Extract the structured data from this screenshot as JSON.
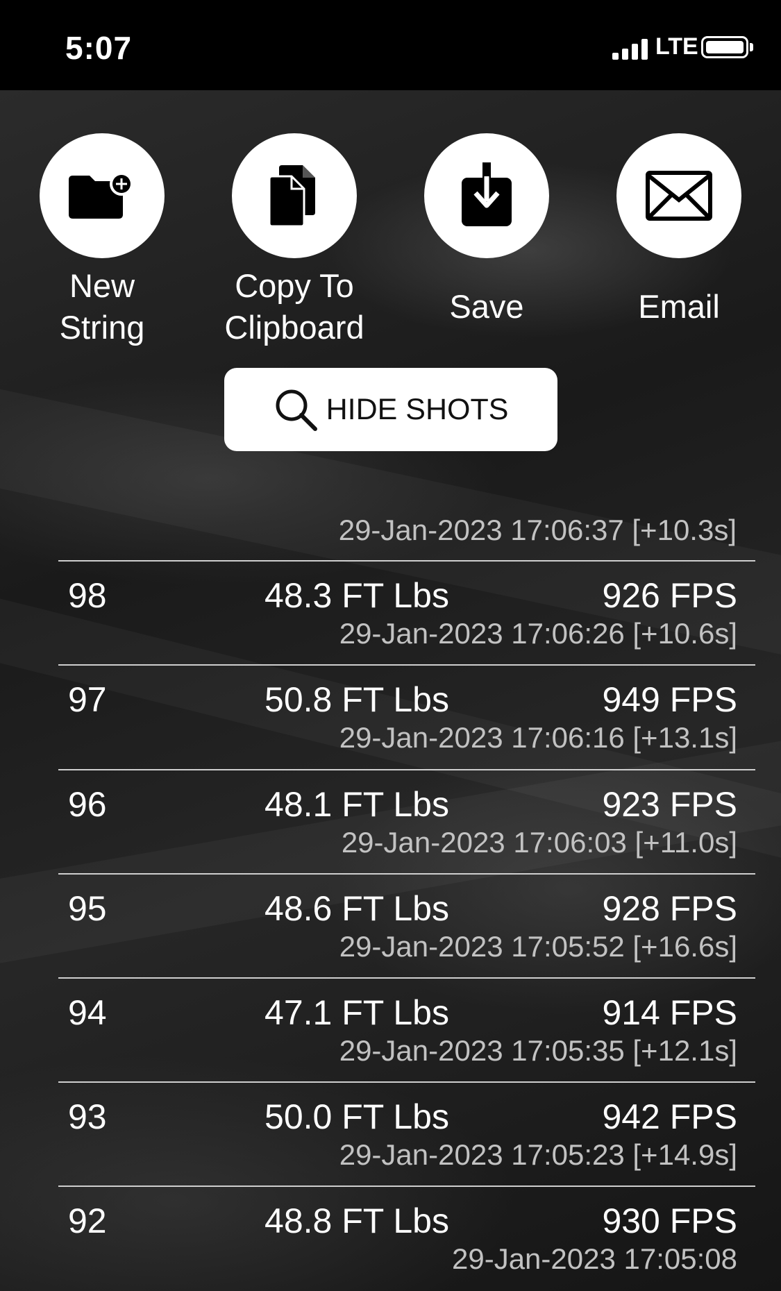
{
  "status_bar": {
    "time": "5:07",
    "network": "LTE"
  },
  "actions": [
    {
      "label": "New\nString",
      "icon": "folder-plus-icon"
    },
    {
      "label": "Copy To\nClipboard",
      "icon": "copy-documents-icon"
    },
    {
      "label": "Save",
      "icon": "download-icon"
    },
    {
      "label": "Email",
      "icon": "envelope-icon"
    }
  ],
  "hide_shots": {
    "label": "HIDE SHOTS",
    "icon": "search-icon"
  },
  "top_timestamp": "29-Jan-2023 17:06:37 [+10.3s]",
  "shots": [
    {
      "number": "98",
      "energy": "48.3 FT Lbs",
      "velocity": "926 FPS",
      "timestamp": "29-Jan-2023 17:06:26 [+10.6s]"
    },
    {
      "number": "97",
      "energy": "50.8 FT Lbs",
      "velocity": "949 FPS",
      "timestamp": "29-Jan-2023 17:06:16 [+13.1s]"
    },
    {
      "number": "96",
      "energy": "48.1 FT Lbs",
      "velocity": "923 FPS",
      "timestamp": "29-Jan-2023 17:06:03 [+11.0s]"
    },
    {
      "number": "95",
      "energy": "48.6 FT Lbs",
      "velocity": "928 FPS",
      "timestamp": "29-Jan-2023 17:05:52 [+16.6s]"
    },
    {
      "number": "94",
      "energy": "47.1 FT Lbs",
      "velocity": "914 FPS",
      "timestamp": "29-Jan-2023 17:05:35 [+12.1s]"
    },
    {
      "number": "93",
      "energy": "50.0 FT Lbs",
      "velocity": "942 FPS",
      "timestamp": "29-Jan-2023 17:05:23 [+14.9s]"
    },
    {
      "number": "92",
      "energy": "48.8 FT Lbs",
      "velocity": "930 FPS",
      "timestamp": "29-Jan-2023 17:05:08"
    }
  ]
}
